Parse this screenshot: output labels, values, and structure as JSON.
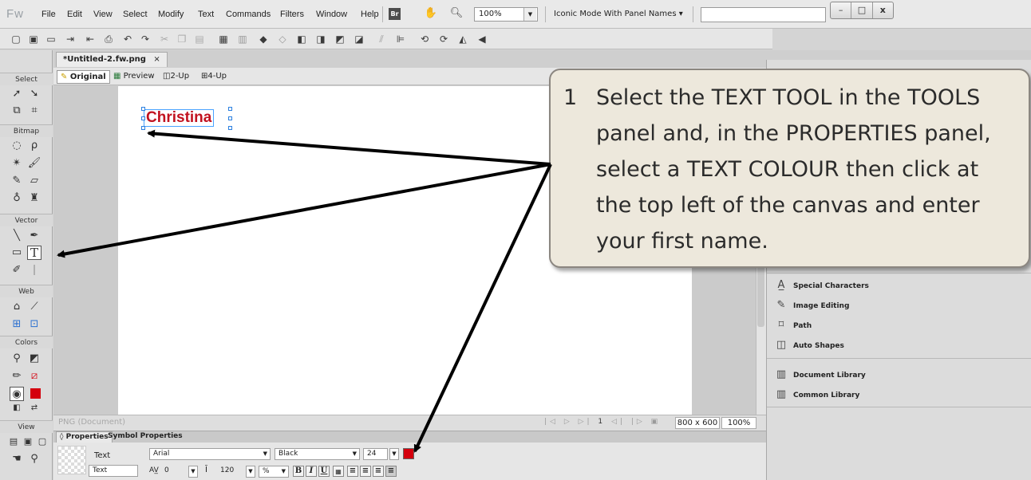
{
  "app": {
    "logo": "Fw"
  },
  "menu": [
    "File",
    "Edit",
    "View",
    "Select",
    "Modify",
    "Text",
    "Commands",
    "Filters",
    "Window",
    "Help"
  ],
  "menubar": {
    "bridge_label": "Br",
    "zoom_value": "100%",
    "workspace": "Iconic Mode With Panel Names ▾"
  },
  "window_controls": {
    "minimize": "–",
    "restore": "□",
    "close": "x"
  },
  "tools": {
    "sections": [
      "Select",
      "Bitmap",
      "Vector",
      "Web",
      "Colors",
      "View"
    ],
    "text_tool_glyph": "T"
  },
  "document": {
    "tab_title": "*Untitled-2.fw.png",
    "tab_close": "×",
    "view_tabs": [
      "Original",
      "Preview",
      "2-Up",
      "4-Up"
    ],
    "canvas_text": "Christina",
    "text_color": "#c1121f"
  },
  "status": {
    "doc_type": "PNG (Document)",
    "frame": "1",
    "canvas_size": "800 x 600",
    "zoom": "100%"
  },
  "properties": {
    "tabs": [
      "Properties",
      "Symbol Properties"
    ],
    "object_type": "Text",
    "object_name": "Text",
    "font": "Arial",
    "style": "Black",
    "size": "24",
    "kerning": "0",
    "leading": "120",
    "leading_unit": "%",
    "fill_color": "#d4000d"
  },
  "right_panel": {
    "items": [
      "Special Characters",
      "Image Editing",
      "Path",
      "Auto Shapes",
      "Document Library",
      "Common Library"
    ]
  },
  "instruction": {
    "number": "1",
    "text": "Select the TEXT TOOL in the TOOLS panel and, in the PROPERTIES panel, select a TEXT COLOUR then click at the top left of the canvas and enter your first name."
  }
}
